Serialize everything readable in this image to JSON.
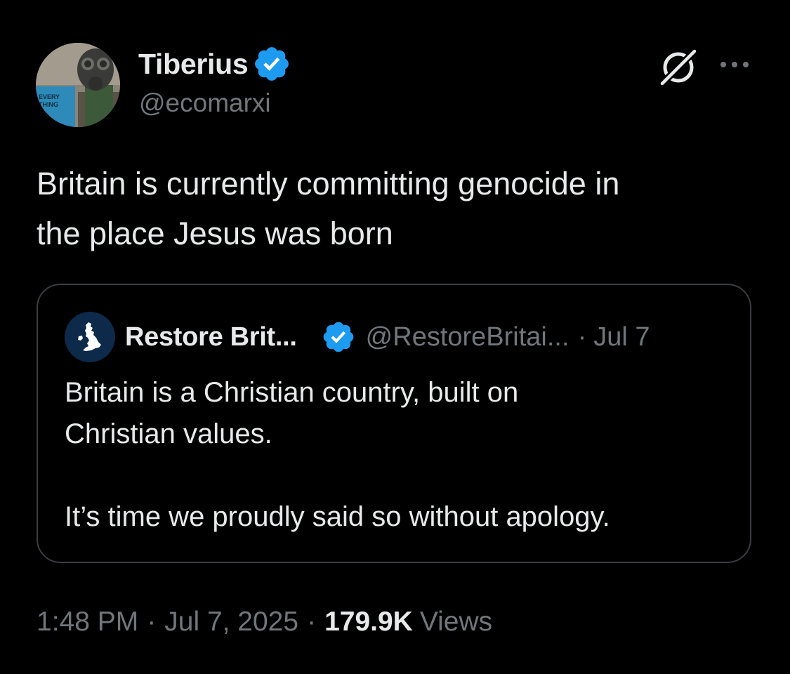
{
  "tweet": {
    "author": {
      "display_name": "Tiberius",
      "handle": "@ecomarxi",
      "avatar_book_text": [
        "EVERY",
        "THING",
        "KED"
      ],
      "verified": true
    },
    "text": "Britain is currently committing genocide in\nthe place Jesus was born",
    "quoted": {
      "display_name": "Restore Brit...",
      "handle": "@RestoreBritai...",
      "separator": "·",
      "date": "Jul 7",
      "verified": true,
      "text": "Britain is a Christian country, built on\nChristian values.\n\nIt’s time we proudly said so without apology."
    },
    "meta": {
      "time": "1:48 PM",
      "separator": "·",
      "date": "Jul 7, 2025",
      "views_count": "179.9K",
      "views_label": "Views"
    }
  },
  "icons": {
    "grok": "grok-icon",
    "more": "more-options-icon",
    "verified": "verified-badge-icon"
  },
  "colors": {
    "background": "#000000",
    "text_primary": "#e7e9ea",
    "text_secondary": "#71767b",
    "verified_blue": "#1d9bf0",
    "card_border": "#3a3d41"
  }
}
